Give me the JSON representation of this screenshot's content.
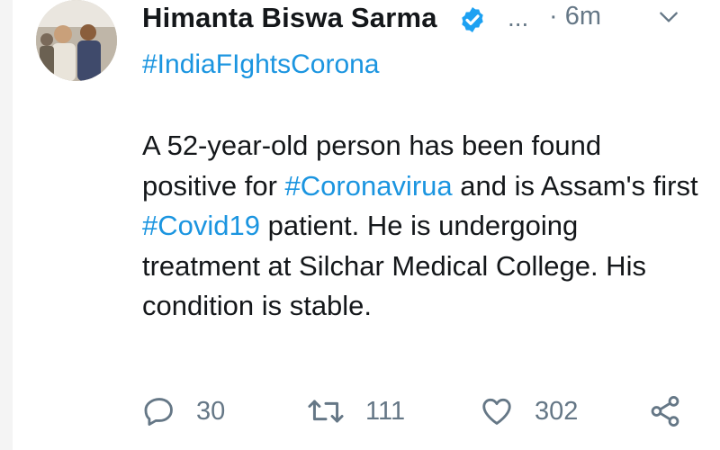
{
  "author": {
    "name": "Himanta Biswa Sarma",
    "avatar_icon": "profile-photo",
    "verified_icon": "verified-badge-icon",
    "verified_color": "#1da1f2"
  },
  "header": {
    "more": "...",
    "timestamp": "· 6m",
    "menu_icon": "chevron-down-icon"
  },
  "tweet": {
    "hashtag_line": "#IndiaFIghtsCorona",
    "body_part1": "A 52-year-old person has been found positive for ",
    "hashtag1": "#Coronavirua",
    "body_part2": " and is Assam's first ",
    "hashtag2": "#Covid19",
    "body_part3": " patient. He is undergoing treatment at Silchar Medical College. His condition is stable."
  },
  "actions": {
    "reply_count": "30",
    "retweet_count": "111",
    "like_count": "302"
  },
  "colors": {
    "link": "#1b95e0",
    "muted": "#657786",
    "text": "#14171a"
  }
}
